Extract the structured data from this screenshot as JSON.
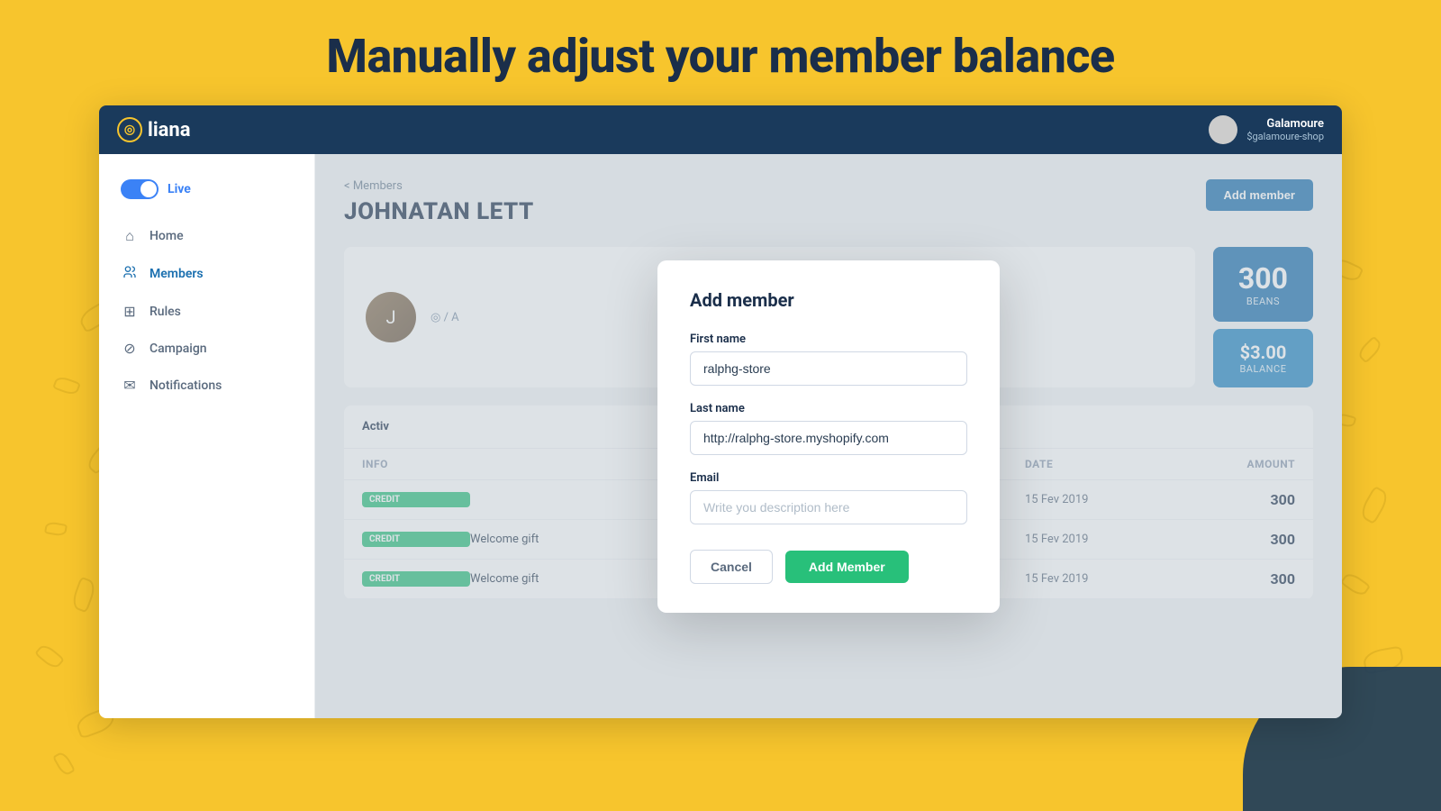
{
  "hero": {
    "title": "Manually adjust your member balance"
  },
  "navbar": {
    "logo_text": "liana",
    "logo_icon": "◎",
    "user_name": "Galamoure",
    "user_shop": "$galamoure-shop"
  },
  "sidebar": {
    "live_label": "Live",
    "items": [
      {
        "id": "home",
        "label": "Home",
        "icon": "⌂"
      },
      {
        "id": "members",
        "label": "Members",
        "icon": "👤"
      },
      {
        "id": "rules",
        "label": "Rules",
        "icon": "⊞"
      },
      {
        "id": "campaign",
        "label": "Campaign",
        "icon": "⊘"
      },
      {
        "id": "notifications",
        "label": "Notifications",
        "icon": "✉"
      }
    ]
  },
  "page": {
    "breadcrumb": "< Members",
    "title": "JOHNATAN LETT",
    "add_member_btn": "Add member"
  },
  "member": {
    "name_sub": "◎ / A",
    "beans": "300",
    "beans_label": "Beans",
    "balance": "$3.00",
    "balance_label": "BALANCE"
  },
  "activity": {
    "header": "Activ",
    "columns": [
      "INFO",
      "",
      "DATE",
      "AMOUNT"
    ],
    "rows": [
      {
        "badge": "credit",
        "info": "",
        "date": "15 Fev 2019",
        "amount": "300"
      },
      {
        "badge": "credit",
        "info": "Welcome gift",
        "date": "15 Fev 2019",
        "amount": "300"
      },
      {
        "badge": "credit",
        "info": "Welcome gift",
        "date": "15 Fev 2019",
        "amount": "300"
      }
    ]
  },
  "modal": {
    "title": "Add member",
    "first_name_label": "First name",
    "first_name_value": "ralphg-store",
    "last_name_label": "Last name",
    "last_name_value": "http://ralphg-store.myshopify.com",
    "email_label": "Email",
    "email_placeholder": "Write you description here",
    "cancel_label": "Cancel",
    "add_label": "Add Member"
  }
}
